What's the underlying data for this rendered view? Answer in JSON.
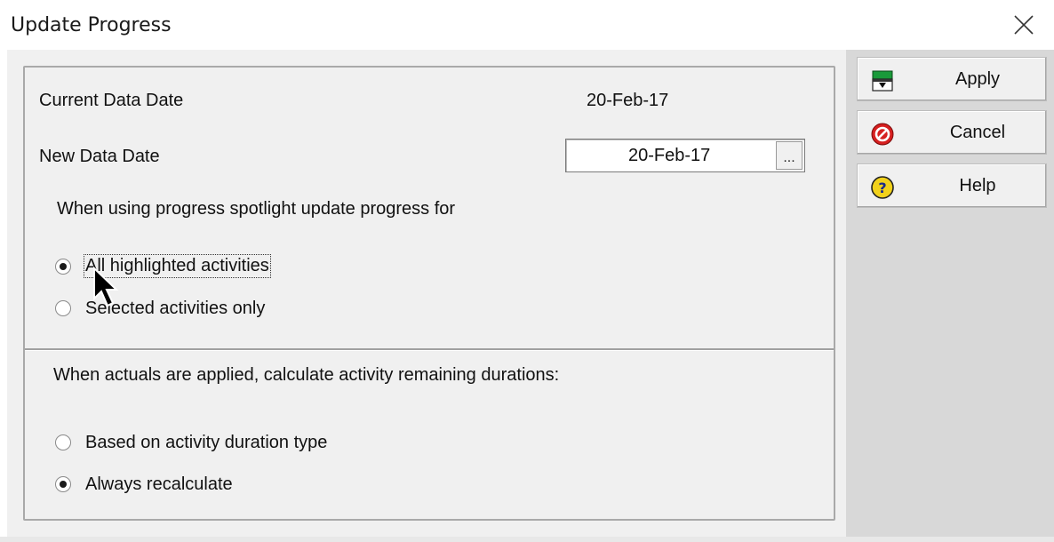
{
  "window": {
    "title": "Update Progress",
    "close_icon": "close-icon"
  },
  "fields": {
    "current_data_date_label": "Current Data Date",
    "current_data_date_value": "20-Feb-17",
    "new_data_date_label": "New Data Date",
    "new_data_date_value": "20-Feb-17",
    "date_picker_button": "..."
  },
  "spotlight_section": {
    "heading": "When using progress spotlight update progress for",
    "options": [
      {
        "label": "All highlighted activities",
        "selected": true
      },
      {
        "label": "Selected activities only",
        "selected": false
      }
    ]
  },
  "durations_section": {
    "heading": "When actuals are applied, calculate activity remaining durations:",
    "options": [
      {
        "label": "Based on activity duration type",
        "selected": false
      },
      {
        "label": "Always recalculate",
        "selected": true
      }
    ]
  },
  "buttons": {
    "apply": "Apply",
    "cancel": "Cancel",
    "help": "Help"
  },
  "colors": {
    "dialog_bg": "#f0f0f0",
    "side_bg": "#d8d8d8",
    "apply_icon_green": "#1a9a3a",
    "cancel_icon_red": "#d62020",
    "help_icon_yellow": "#f2d21b"
  }
}
